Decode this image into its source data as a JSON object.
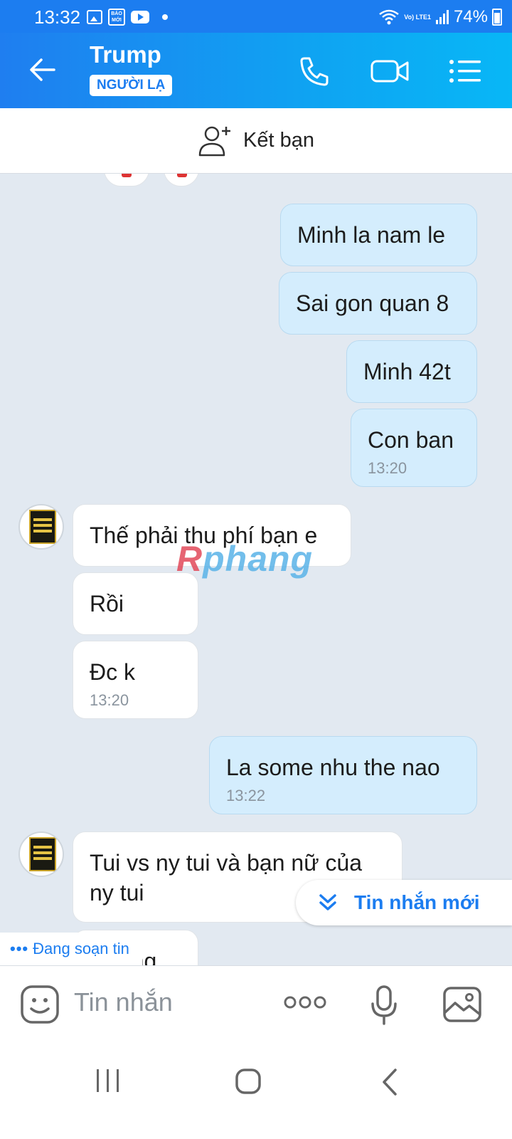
{
  "status_bar": {
    "time": "13:32",
    "baomoi_label": "BÁO MỚI",
    "network": "Vo) LTE1",
    "battery": "74%"
  },
  "header": {
    "contact_name": "Trump",
    "badge": "NGƯỜI LẠ",
    "icons": [
      "back-arrow-icon",
      "phone-icon",
      "video-call-icon",
      "menu-list-icon"
    ]
  },
  "add_friend": {
    "label": "Kết bạn"
  },
  "messages": [
    {
      "dir": "out",
      "text": "Minh la nam le"
    },
    {
      "dir": "out",
      "text": "Sai gon quan 8"
    },
    {
      "dir": "out",
      "text": "Minh 42t"
    },
    {
      "dir": "out",
      "text": "Con ban",
      "time": "13:20"
    },
    {
      "dir": "in",
      "text": "Thế phải thu phí bạn e"
    },
    {
      "dir": "in",
      "text": "Rồi"
    },
    {
      "dir": "in",
      "text": "Đc k",
      "time": "13:20"
    },
    {
      "dir": "out",
      "text": "La some nhu the nao",
      "time": "13:22"
    },
    {
      "dir": "in",
      "text": "Tui vs ny tui và bạn nữ của ny tui"
    },
    {
      "dir": "in",
      "text": "vs ông"
    }
  ],
  "typing_indicator": "Đang soạn tin",
  "new_messages_button": "Tin nhắn mới",
  "watermark": {
    "first": "R",
    "rest": "phang"
  },
  "input": {
    "placeholder": "Tin nhắn"
  },
  "colors": {
    "brand_blue": "#1c7df0",
    "outgoing_bubble": "#d4edfd",
    "chat_bg": "#e2e9f1"
  }
}
